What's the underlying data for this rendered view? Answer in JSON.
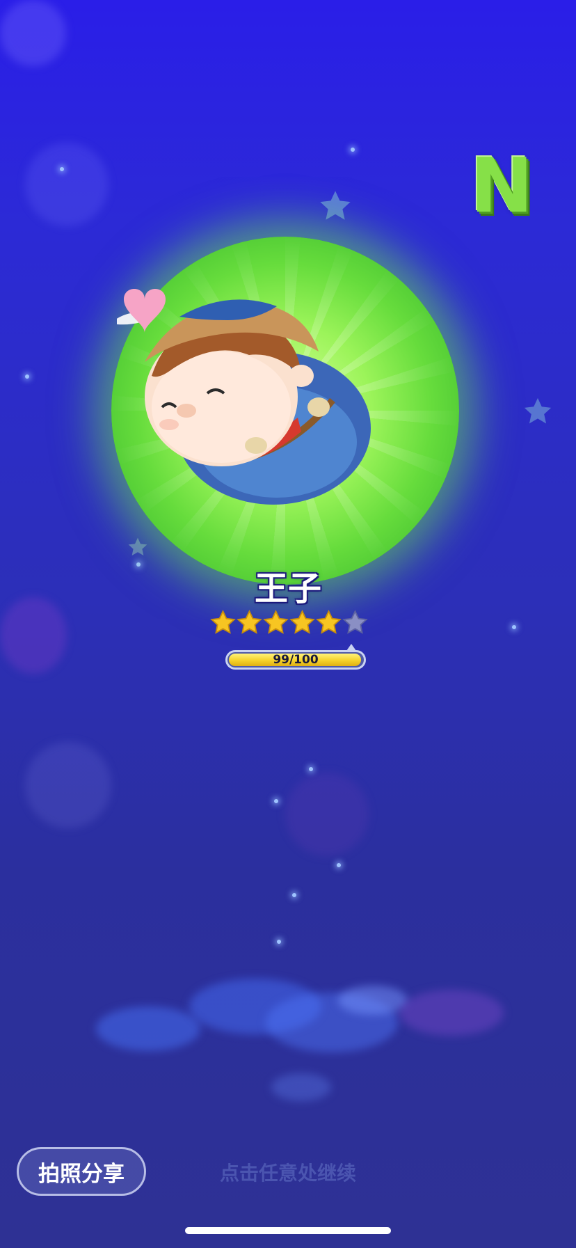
{
  "character": {
    "name": "王子",
    "rarity": "N",
    "star_level": 5,
    "max_stars": 6
  },
  "progress": {
    "label": "99/100",
    "current": 99,
    "max": 100
  },
  "buttons": {
    "share_label": "拍照分享"
  },
  "hint": {
    "continue_text": "点击任意处继续"
  },
  "colors": {
    "background": "#2c2ad6",
    "glow": "#66dc3c",
    "rarity_badge": "#86e048",
    "star_filled": "#f7c522",
    "star_empty": "#8a8fc4",
    "progress_fill": "#f5d22b"
  },
  "icons": {
    "rarity": "rarity-n-badge",
    "star_filled": "star-filled-icon",
    "star_empty": "star-empty-icon"
  }
}
